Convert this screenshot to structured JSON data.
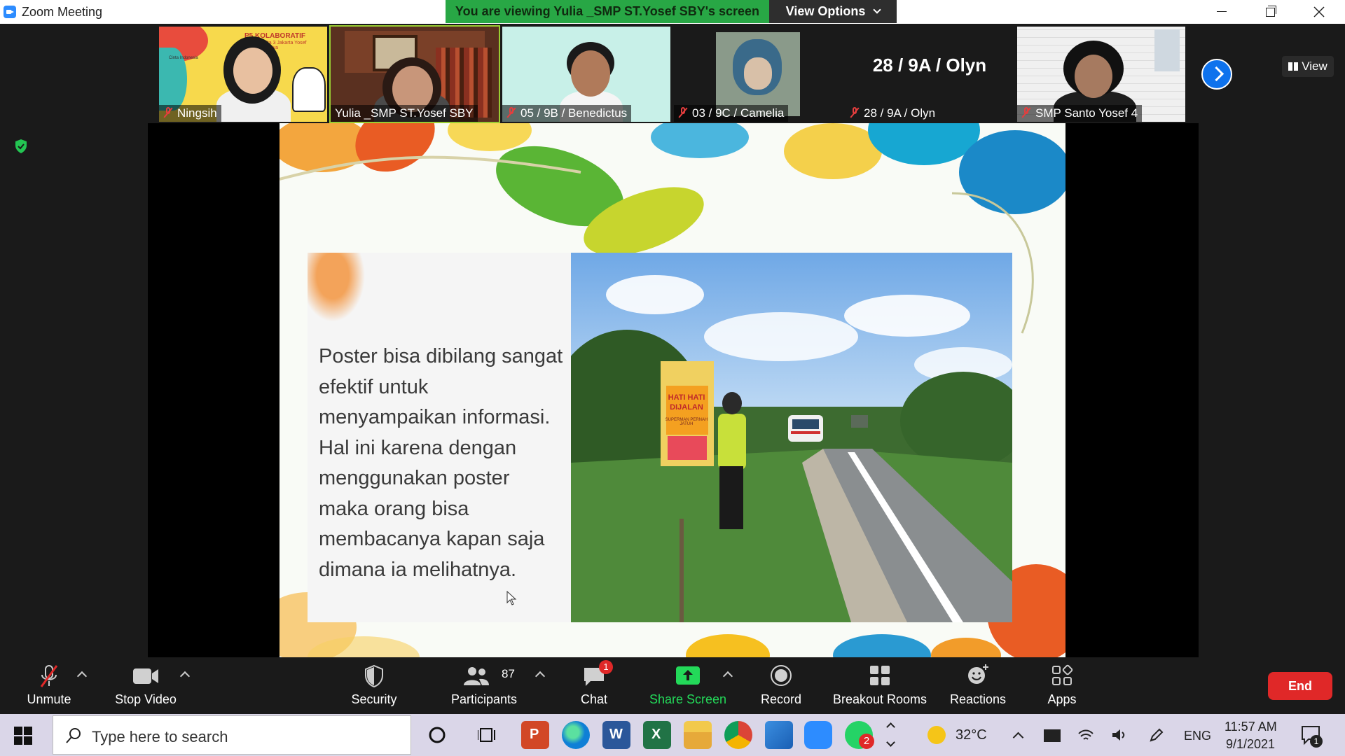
{
  "window": {
    "title": "Zoom Meeting",
    "viewing_banner": "You are viewing Yulia _SMP ST.Yosef SBY's screen",
    "view_options_label": "View Options",
    "view_label": "View"
  },
  "gallery": [
    {
      "name": "Ningsih",
      "muted": true
    },
    {
      "name": "Yulia _SMP ST.Yosef SBY",
      "muted": false,
      "active": true
    },
    {
      "name": "05 / 9B / Benedictus",
      "muted": true
    },
    {
      "name": "03 / 9C / Camelia",
      "muted": true
    },
    {
      "name": "28 / 9A / Olyn",
      "muted": true,
      "no_video": true
    },
    {
      "name": "SMP Santo Yosef 4",
      "muted": true
    }
  ],
  "gallery_thumb_text": {
    "ningsih_banner": "P5 KOLABORATIF",
    "ningsih_sub": "Ganita 3 Jakarta Yosef Surabaya",
    "ningsih_small": "Cinta Indonesia"
  },
  "slide": {
    "text": "Poster bisa dibilang sangat efektif untuk menyampaikan informasi. Hal ini karena dengan menggunakan poster maka orang bisa membacanya kapan saja dimana ia melihatnya.",
    "poster_text": "HATI HATI DIJALAN",
    "poster_sub": "SUPERMAN PERNAH JATUH"
  },
  "toolbar": {
    "unmute": "Unmute",
    "stop_video": "Stop Video",
    "security": "Security",
    "participants": "Participants",
    "participants_count": "87",
    "chat": "Chat",
    "chat_badge": "1",
    "share_screen": "Share Screen",
    "record": "Record",
    "breakout_rooms": "Breakout Rooms",
    "reactions": "Reactions",
    "apps": "Apps",
    "end": "End"
  },
  "taskbar": {
    "search_placeholder": "Type here to search",
    "weather": "32°C",
    "language": "ENG",
    "time": "11:57 AM",
    "date": "9/1/2021",
    "whatsapp_badge": "2",
    "notification_badge": "1"
  },
  "colors": {
    "accent_green": "#28a745",
    "zoom_blue": "#0e72ed",
    "end_red": "#e02828",
    "share_green": "#23d959"
  }
}
